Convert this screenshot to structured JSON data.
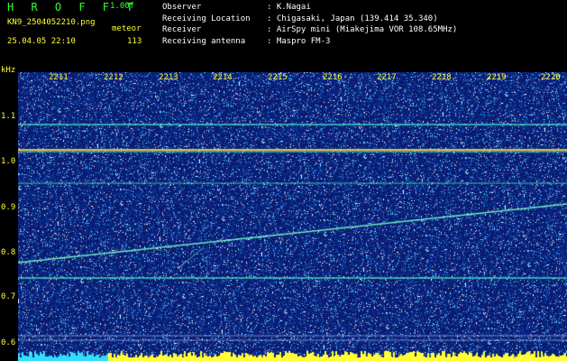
{
  "header": {
    "app_title": "H R O F F T",
    "version": "1.00f",
    "filename": "KN9_2504052210.png",
    "date_time": "25.04.05 22:10",
    "meteor_label": "meteor",
    "meteor_count": "113"
  },
  "info": {
    "rows": [
      {
        "label": "Observer",
        "value": ": K.Nagai"
      },
      {
        "label": "Receiving Location",
        "value": ": Chigasaki, Japan (139.414 35.340)"
      },
      {
        "label": "Receiver",
        "value": ": AirSpy mini (Miakejima VOR 108.65MHz)"
      },
      {
        "label": "Receiving antenna",
        "value": ": Maspro FM-3"
      }
    ]
  },
  "axes": {
    "y_unit": "kHz",
    "y_ticks": [
      "1.1",
      "1.0",
      "0.9",
      "0.8",
      "0.7",
      "0.6"
    ],
    "x_ticks": [
      "2211",
      "2212",
      "2213",
      "2214",
      "2215",
      "2216",
      "2217",
      "2218",
      "2219",
      "2220"
    ]
  },
  "colors": {
    "background": "#000000",
    "plot_bg": "#0a1a6e",
    "label_yellow": "#ffff33",
    "title_green": "#33ff33"
  }
}
